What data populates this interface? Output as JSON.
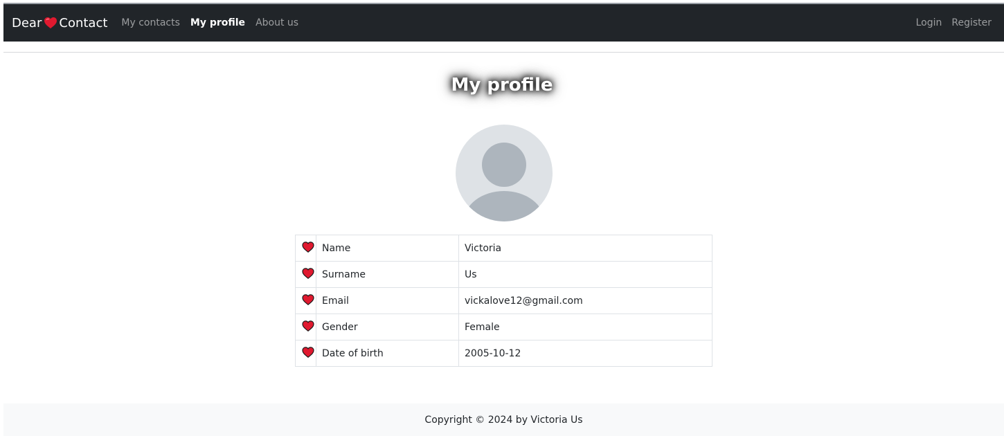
{
  "navbar": {
    "brand_left": "Dear",
    "brand_right": "Contact",
    "links": [
      "My contacts",
      "My profile",
      "About us"
    ],
    "active_link": "My profile",
    "auth": [
      "Login",
      "Register"
    ]
  },
  "page": {
    "title": "My profile"
  },
  "profile": {
    "rows": [
      {
        "label": "Name",
        "value": "Victoria"
      },
      {
        "label": "Surname",
        "value": "Us"
      },
      {
        "label": "Email",
        "value": "vickalove12@gmail.com"
      },
      {
        "label": "Gender",
        "value": "Female"
      },
      {
        "label": "Date of birth",
        "value": "2005-10-12"
      }
    ]
  },
  "footer": {
    "text": "Copyright © 2024 by Victoria Us"
  },
  "icons": {
    "brand": "heart-icon",
    "row": "heart-icon",
    "avatar": "user-placeholder-icon"
  },
  "colors": {
    "navbar_bg": "#212529",
    "heart": "#e0192f",
    "footer_bg": "#f8f9fa",
    "avatar_bg": "#dee2e6",
    "avatar_fg": "#adb5bd"
  }
}
